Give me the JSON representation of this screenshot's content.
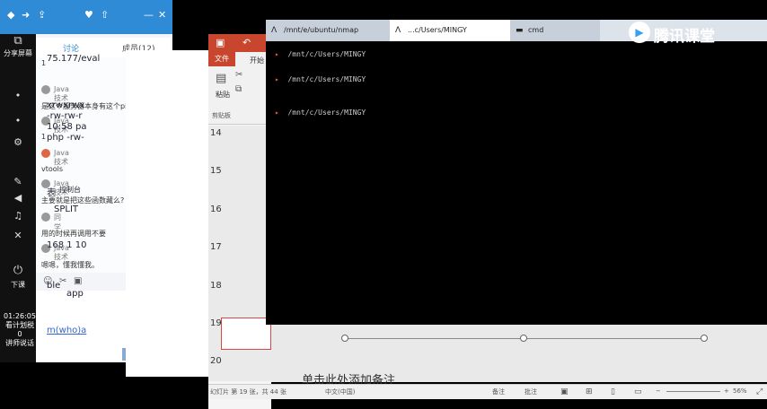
{
  "taskbar": {
    "share_screen": "分享屏幕",
    "end_class": "下课",
    "time": "01:26:05",
    "info_line1": "看计划税",
    "info_line2": "0",
    "info_line3": "讲师说话"
  },
  "chat": {
    "tabs": [
      "讨论",
      "成员(12)"
    ],
    "messages": [
      {
        "name": "Java技术",
        "text": "1"
      },
      {
        "name": "Java技术",
        "text": "是这个服务器本身有这个php文件么?"
      },
      {
        "name": "Java技术",
        "text": "1"
      },
      {
        "name": "Java技术",
        "text": "vtools"
      },
      {
        "name": "Java技术",
        "text": "主要就是把这些函数藏么?"
      },
      {
        "name": "同学",
        "text": "用的时候再调用不要"
      },
      {
        "name": "Java技术",
        "text": "嗯嗯，懂我懂我。"
      }
    ],
    "send_label": "发送"
  },
  "terminal_fragment": {
    "lines": [
      "75.177/eval",
      "xrwxrwx",
      "-rw-rw-r",
      "10:58 pa",
      "php -rw-",
      "表",
      "控制台",
      "SPLIT",
      "168 1 10",
      "ble",
      "app",
      "m(who)a"
    ]
  },
  "powerpoint": {
    "file_tab": "文件",
    "home_tab": "开始",
    "paste_label": "粘贴",
    "clipboard_label": "剪贴板",
    "slides": [
      14,
      15,
      16,
      17,
      18,
      19,
      20
    ],
    "notes_placeholder": "单击此处添加备注",
    "status_slide": "幻灯片 第 19 张，共 44 张",
    "status_lang": "中文(中国)",
    "status_notes": "备注",
    "status_comments": "批注",
    "zoom": "56%"
  },
  "terminal": {
    "tabs": [
      {
        "label": "/mnt/e/ubuntu/nmap",
        "icon": "Λ"
      },
      {
        "label": "...c/Users/MINGY",
        "icon": "Λ"
      },
      {
        "label": "cmd",
        "icon": "▬"
      }
    ],
    "lines": [
      "/mnt/c/Users/MINGY",
      "/mnt/c/Users/MINGY",
      "/mnt/c/Users/MINGY"
    ]
  },
  "watermark": "腾讯课堂"
}
